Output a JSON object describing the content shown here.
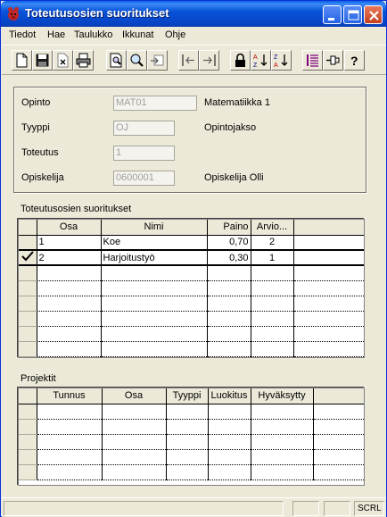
{
  "window": {
    "title": "Toteutusosien suoritukset"
  },
  "menu": {
    "items": [
      "Tiedot",
      "Hae",
      "Taulukko",
      "Ikkunat",
      "Ohje"
    ]
  },
  "toolbar": {
    "buttons": [
      "new-icon",
      "save-icon",
      "delete-icon",
      "print-icon",
      "print-preview-icon",
      "zoom-icon",
      "go-icon",
      "import-icon",
      "export-icon",
      "lock-icon",
      "sort-asc-icon",
      "sort-desc-icon",
      "list-icon",
      "pin-icon",
      "help-icon"
    ]
  },
  "form": {
    "opinto_label": "Opinto",
    "opinto_value": "MAT01",
    "opinto_desc": "Matematiikka 1",
    "tyyppi_label": "Tyyppi",
    "tyyppi_value": "OJ",
    "tyyppi_desc": "Opintojakso",
    "toteutus_label": "Toteutus",
    "toteutus_value": "1",
    "opiskelija_label": "Opiskelija",
    "opiskelija_value": "0600001",
    "opiskelija_desc": "Opiskelija Olli"
  },
  "suoritukset": {
    "label": "Toteutusosien suoritukset",
    "columns": [
      "Osa",
      "Nimi",
      "Paino",
      "Arvio..."
    ],
    "rows": [
      {
        "osa": "1",
        "nimi": "Koe",
        "paino": "0,70",
        "arvio": "2"
      },
      {
        "osa": "2",
        "nimi": "Harjoitustyö",
        "paino": "0,30",
        "arvio": "1"
      }
    ]
  },
  "projektit": {
    "label": "Projektit",
    "columns": [
      "Tunnus",
      "Osa",
      "Tyyppi",
      "Luokitus",
      "Hyväksytty"
    ]
  },
  "statusbar": {
    "scrl": "SCRL"
  }
}
